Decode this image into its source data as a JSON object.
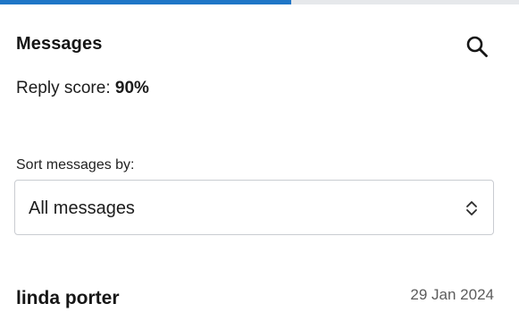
{
  "tabs": {
    "active_index": 0
  },
  "header": {
    "title": "Messages",
    "search_icon": "search-icon"
  },
  "reply_score": {
    "label": "Reply score: ",
    "value": "90%"
  },
  "sort": {
    "label": "Sort messages by:",
    "selected": "All messages",
    "chevron_icon": "chevron-up-down-icon"
  },
  "messages": [
    {
      "sender": "linda porter",
      "date": "29 Jan 2024"
    }
  ],
  "colors": {
    "accent": "#1f76c7",
    "tab_track": "#e6e8eb",
    "border": "#c9ccd1",
    "muted_text": "#5c5c5c"
  }
}
